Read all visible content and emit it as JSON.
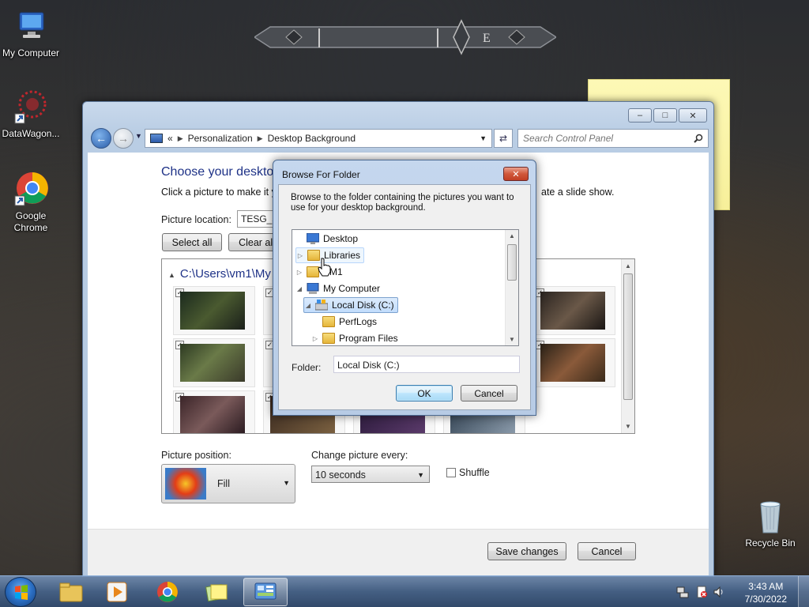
{
  "desktop": {
    "icons": [
      {
        "label": "My Computer"
      },
      {
        "label": "DataWagon..."
      },
      {
        "label": "Google Chrome"
      },
      {
        "label": "Recycle Bin"
      }
    ],
    "banner_letters": "E"
  },
  "window": {
    "controls": {
      "minimize": "–",
      "maximize": "□",
      "close": "✕"
    },
    "breadcrumb": {
      "overflow": "«",
      "items": [
        "Personalization",
        "Desktop Background"
      ]
    },
    "search": {
      "placeholder": "Search Control Panel"
    },
    "page_title": "Choose your desktop",
    "description_start": "Click a picture to make it y",
    "description_end": "ate a slide show.",
    "picture_location_label": "Picture location:",
    "picture_location_value": "TESG_sc",
    "select_all": "Select all",
    "clear_all": "Clear all",
    "gallery_header": "C:\\Users\\vm1\\My P",
    "picture_position_label": "Picture position:",
    "picture_position_value": "Fill",
    "change_picture_label": "Change picture every:",
    "change_picture_value": "10 seconds",
    "shuffle_label": "Shuffle",
    "save_changes": "Save changes",
    "cancel": "Cancel"
  },
  "dialog": {
    "title": "Browse For Folder",
    "close": "✕",
    "description": "Browse to the folder containing the pictures you want to use for your desktop background.",
    "tree": [
      {
        "label": "Desktop",
        "expander": "",
        "icon": "desktop-icon"
      },
      {
        "label": "Libraries",
        "expander": "▷",
        "icon": "libraries-icon"
      },
      {
        "label": "VM1",
        "expander": "▷",
        "icon": "user-folder-icon"
      },
      {
        "label": "My Computer",
        "expander": "◢",
        "icon": "computer-icon"
      },
      {
        "label": "Local Disk (C:)",
        "expander": "◢",
        "icon": "drive-icon"
      },
      {
        "label": "PerfLogs",
        "expander": "",
        "icon": "folder-icon"
      },
      {
        "label": "Program Files",
        "expander": "▷",
        "icon": "folder-icon"
      }
    ],
    "folder_label": "Folder:",
    "folder_value": "Local Disk (C:)",
    "ok": "OK",
    "cancel": "Cancel"
  },
  "taskbar": {
    "time": "3:43 AM",
    "date": "7/30/2022"
  }
}
